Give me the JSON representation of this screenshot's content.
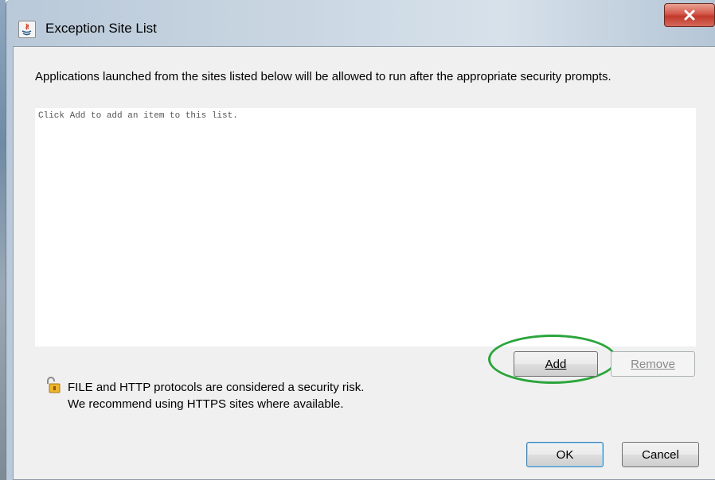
{
  "window": {
    "title": "Exception Site List",
    "close_symbol": "x"
  },
  "description": "Applications launched from the sites listed below will be allowed to run after the appropriate security prompts.",
  "site_list": {
    "placeholder": "Click Add to add an item to this list."
  },
  "buttons": {
    "add_label": "Add",
    "remove_label": "Remove",
    "ok_label": "OK",
    "cancel_label": "Cancel"
  },
  "warning": {
    "line1": "FILE and HTTP protocols are considered a security risk.",
    "line2": "We recommend using HTTPS sites where available."
  },
  "icons": {
    "title_icon": "java-icon",
    "warning_icon": "unlocked-padlock-icon",
    "close_icon": "close-icon"
  },
  "annotation": {
    "color": "#2aa53b"
  }
}
